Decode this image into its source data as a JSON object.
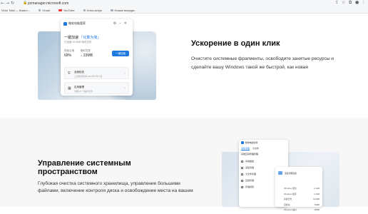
{
  "browser": {
    "url": "pcmanager.microsoft.com",
    "bookmarks": [
      {
        "label": "Virus Total — Компл..."
      },
      {
        "label": "Gmail"
      },
      {
        "label": "YouTube"
      },
      {
        "label": "Ключ-инфо"
      },
      {
        "label": "Новые вкладки"
      }
    ]
  },
  "hero_app": {
    "title": "微软电脑管家",
    "headline_prefix": "一键加速",
    "headline_suffix": "「化繁为简」",
    "subline": "已加速 20.9MB 临时文件",
    "stat1_label": "内存占用",
    "stat1_value": "69%",
    "stat2_label": "临时文件",
    "stat2_value": "↓ 23MB",
    "boost_label": "一键加速",
    "card1_title": "全面检查",
    "card1_sub": "上次检查时间 2022年7月14日",
    "card2_title": "应用管理",
    "card2_sub": "清理 24 个临时文件"
  },
  "section1": {
    "title": "Ускорение в один клик",
    "body": "Очистите системные фрагменты, освободите занятые ресурсы и сделайте вашу Windows такой же быстрой, как новая"
  },
  "section2": {
    "title": "Управление системным пространством",
    "body": "Глубокая очистка системного хранилища, управление большими файлами, включение контроля диска и освобождение места на вашем"
  },
  "storage_app": {
    "title": "微软电脑管家",
    "heading": "系统空间管理管理",
    "tabs": [
      "深度清理",
      "大文件"
    ],
    "side_items": [
      "系统磁盘",
      "深度清理",
      "大文件管理",
      "应用管理",
      "存储感知"
    ],
    "panel_title": "深度清理完成",
    "panel_rows": [
      {
        "name": "Windows 更新",
        "size": "2.1GB"
      },
      {
        "name": "Windows 缓存",
        "size": "1.3GB"
      },
      {
        "name": "系统日志",
        "size": "612MB"
      },
      {
        "name": "回收站",
        "size": "94MB"
      },
      {
        "name": "Windows 临时",
        "size": "48MB"
      }
    ]
  },
  "colors": {
    "accent": "#1f7ae0",
    "band": "#f7f7f7"
  }
}
